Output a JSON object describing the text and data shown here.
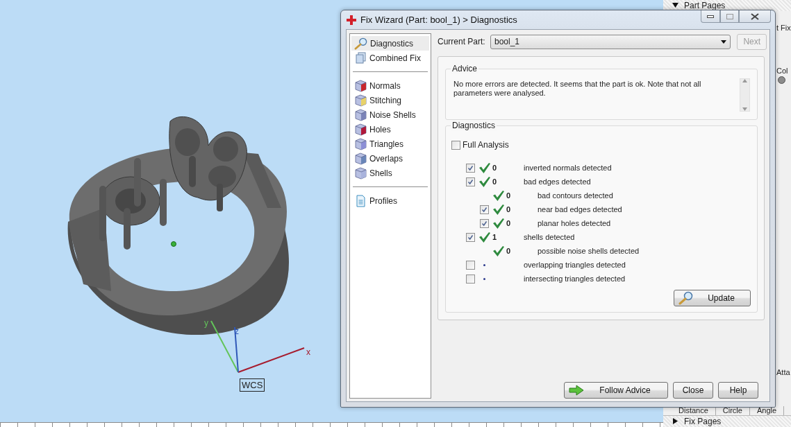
{
  "viewport": {
    "axes": [
      {
        "label": "x"
      },
      {
        "label": "y"
      },
      {
        "label": "z"
      }
    ],
    "frame_label": "WCS"
  },
  "side_panel": {
    "header": {
      "label": "Part Pages",
      "expanded": true
    },
    "tab_fragment": "t Fix",
    "column_fragment": "Col",
    "label_fragment": "Atta",
    "tabs": [
      {
        "label": "Distance"
      },
      {
        "label": "Circle"
      },
      {
        "label": "Angle"
      }
    ],
    "footer": {
      "label": "Fix Pages",
      "expanded": false
    }
  },
  "dialog": {
    "title": "Fix Wizard (Part: bool_1) > Diagnostics",
    "nav": [
      [
        {
          "label": "Diagnostics",
          "selected": true
        },
        {
          "label": "Combined Fix",
          "selected": false
        }
      ],
      [
        {
          "label": "Normals",
          "selected": false
        },
        {
          "label": "Stitching",
          "selected": false
        },
        {
          "label": "Noise Shells",
          "selected": false
        },
        {
          "label": "Holes",
          "selected": false
        },
        {
          "label": "Triangles",
          "selected": false
        },
        {
          "label": "Overlaps",
          "selected": false
        },
        {
          "label": "Shells",
          "selected": false
        }
      ],
      [
        {
          "label": "Profiles",
          "selected": false
        }
      ]
    ],
    "current_part": {
      "label": "Current Part:",
      "value": "bool_1"
    },
    "next_button": {
      "label": "Next",
      "disabled": true
    },
    "advice": {
      "title": "Advice",
      "text": "No more errors are detected. It seems that the part is ok. Note that not all parameters were analysed."
    },
    "diagnostics": {
      "title": "Diagnostics",
      "full_analysis": {
        "label": "Full Analysis",
        "checked": false
      },
      "rows": [
        {
          "kind": "checkbox",
          "checked": true,
          "passed": true,
          "count": "0",
          "label": "inverted normals detected"
        },
        {
          "kind": "checkbox",
          "checked": true,
          "passed": true,
          "count": "0",
          "label": "bad edges detected",
          "children": [
            {
              "kind": "plain",
              "passed": true,
              "count": "0",
              "label": "bad contours detected"
            },
            {
              "kind": "checkbox",
              "checked": true,
              "passed": true,
              "count": "0",
              "label": "near bad edges detected"
            },
            {
              "kind": "checkbox",
              "checked": true,
              "passed": true,
              "count": "0",
              "label": "planar holes detected"
            }
          ]
        },
        {
          "kind": "checkbox",
          "checked": true,
          "passed": true,
          "count": "1",
          "label": "shells detected",
          "children": [
            {
              "kind": "plain",
              "passed": true,
              "count": "0",
              "label": "possible noise shells detected"
            }
          ]
        },
        {
          "kind": "checkbox",
          "checked": false,
          "passed": false,
          "label": "overlapping triangles detected"
        },
        {
          "kind": "checkbox",
          "checked": false,
          "passed": false,
          "label": "intersecting triangles detected"
        }
      ]
    },
    "update_button": "Update",
    "buttons": [
      "Follow Advice",
      "Close",
      "Help"
    ]
  }
}
